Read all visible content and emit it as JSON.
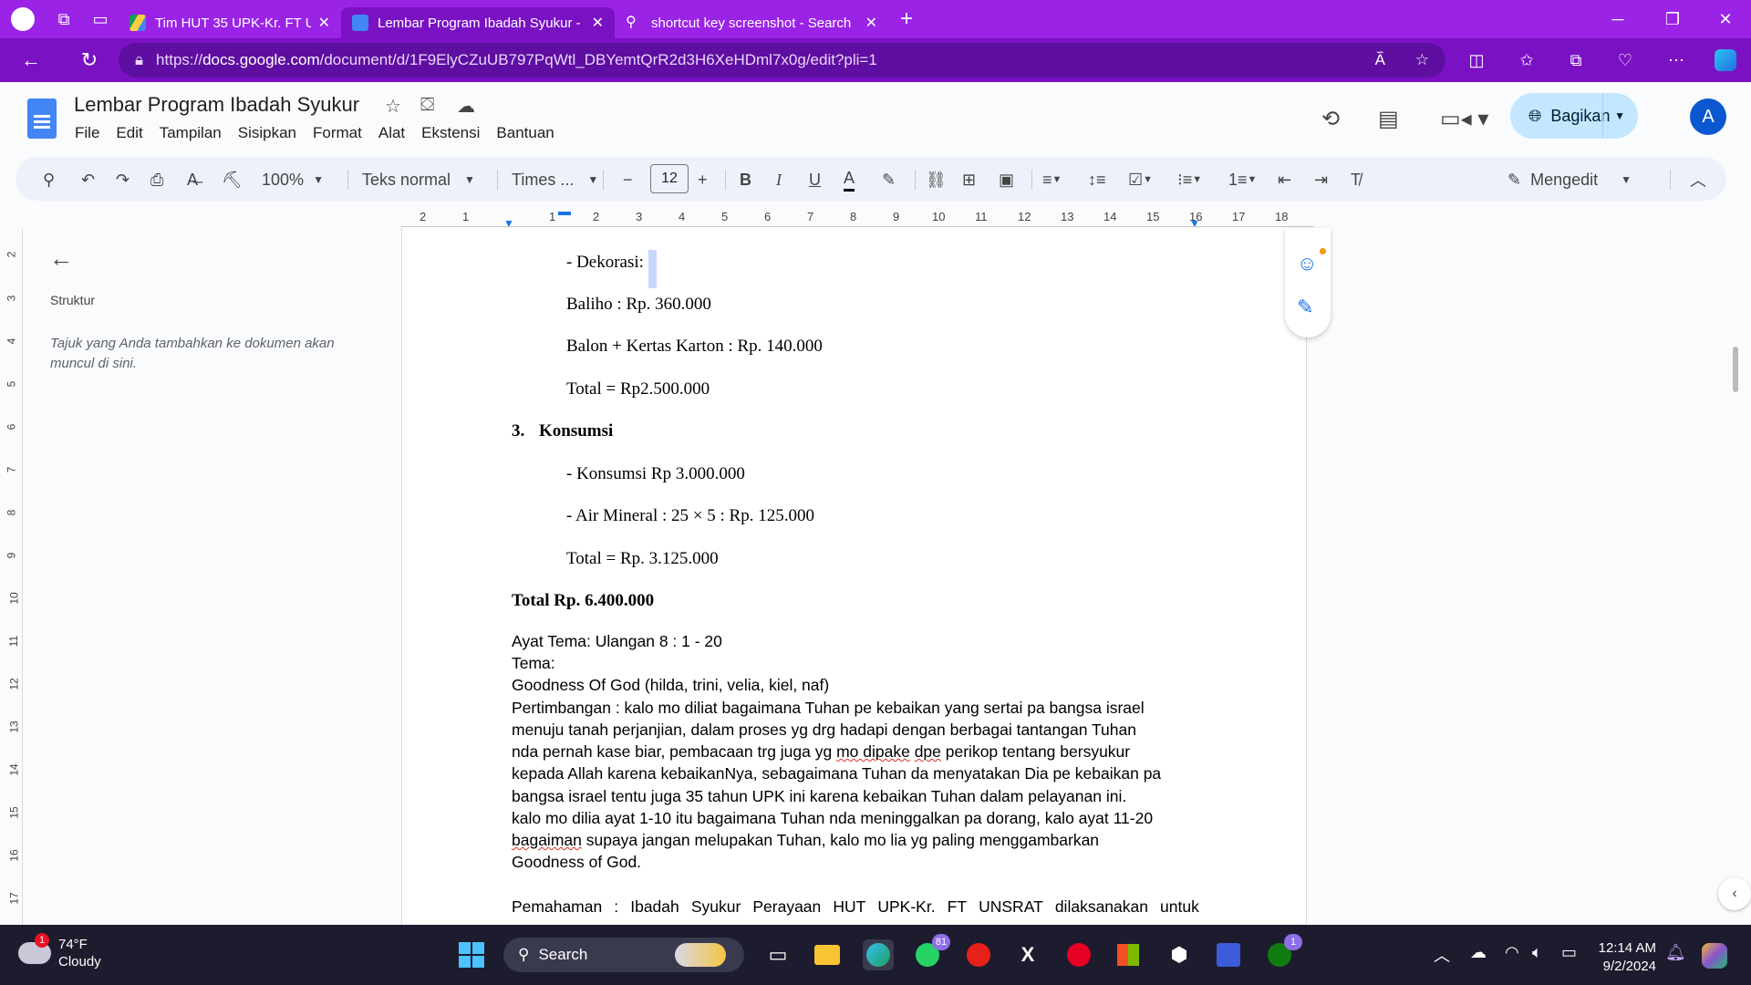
{
  "browser": {
    "tabs": [
      {
        "title": "Tim HUT 35 UPK-Kr. FT UNSRAT -",
        "active": false,
        "favicon": "google-drive-icon"
      },
      {
        "title": "Lembar Program Ibadah Syukur -",
        "active": true,
        "favicon": "google-docs-icon"
      },
      {
        "title": "shortcut key screenshot - Search",
        "active": false,
        "favicon": "search-icon"
      }
    ],
    "url_prefix": "https://",
    "url_host": "docs.google.com",
    "url_path": "/document/d/1F9ElyCZuUB797PqWtl_DBYemtQrR2d3H6XeHDml7x0g/edit?pli=1",
    "accent_color": "#9a23e6"
  },
  "docs": {
    "title": "Lembar Program Ibadah Syukur",
    "menu": [
      "File",
      "Edit",
      "Tampilan",
      "Sisipkan",
      "Format",
      "Alat",
      "Ekstensi",
      "Bantuan"
    ],
    "share_label": "Bagikan",
    "avatar_letter": "A",
    "toolbar": {
      "zoom": "100%",
      "style": "Teks normal",
      "font": "Times ...",
      "font_size": "12",
      "mode": "Mengedit"
    },
    "ruler_ticks": [
      "2",
      "1",
      "1",
      "2",
      "3",
      "4",
      "5",
      "6",
      "7",
      "8",
      "9",
      "10",
      "11",
      "12",
      "13",
      "14",
      "15",
      "16",
      "17",
      "18"
    ],
    "vruler_ticks": [
      "2",
      "3",
      "4",
      "5",
      "6",
      "7",
      "8",
      "9",
      "10",
      "11",
      "12",
      "13",
      "14",
      "15",
      "16",
      "17"
    ]
  },
  "outline": {
    "label": "Struktur",
    "hint": "Tajuk yang Anda tambahkan ke dokumen akan muncul di sini."
  },
  "document": {
    "l1": "- Dekorasi:",
    "l2": "Baliho : Rp. 360.000",
    "l3": "Balon + Kertas Karton : Rp. 140.000",
    "l4": "Total = Rp2.500.000",
    "l5_num": "3.",
    "l5": "Konsumsi",
    "l6": "- Konsumsi Rp 3.000.000",
    "l7": "- Air Mineral : 25 × 5 : Rp. 125.000",
    "l8": "Total = Rp. 3.125.000",
    "l9": "Total Rp. 6.400.000",
    "l10": "Ayat Tema:  Ulangan 8 : 1 - 20",
    "l11": "Tema:",
    "l12": "Goodness Of God (hilda, trini, velia, kiel, naf)",
    "l13": "Pertimbangan : kalo mo diliat bagaimana Tuhan pe kebaikan yang sertai pa bangsa israel",
    "l14": "menuju tanah perjanjian, dalam proses yg drg hadapi dengan berbagai tantangan Tuhan",
    "l15a": "nda pernah kase biar, pembacaan trg juga yg ",
    "l15b": "mo dipake",
    "l15c": " ",
    "l15d": "dpe",
    "l15e": " perikop tentang bersyukur",
    "l16": "kepada Allah karena kebaikanNya, sebagaimana Tuhan da menyatakan Dia pe kebaikan pa",
    "l17": "bangsa israel tentu juga 35 tahun UPK ini karena kebaikan Tuhan dalam pelayanan ini.",
    "l18": "kalo mo dilia ayat 1-10 itu bagaimana Tuhan nda meninggalkan pa dorang, kalo ayat 11-20",
    "l19a": "bagaiman",
    "l19b": " supaya jangan melupakan Tuhan, kalo mo lia yg paling menggambarkan",
    "l20": "Goodness of God.",
    "l21": [
      "Pemahaman",
      ":",
      "Ibadah",
      "Syukur",
      "Perayaan",
      "HUT",
      "UPK-Kr.",
      "FT",
      "UNSRAT",
      "dilaksanakan",
      "untuk"
    ]
  },
  "taskbar": {
    "temperature": "74°F",
    "condition": "Cloudy",
    "weather_badge": "1",
    "search_label": "Search",
    "whatsapp_badge": "81",
    "xbox_badge": "1",
    "time": "12:14 AM",
    "date": "9/2/2024"
  }
}
